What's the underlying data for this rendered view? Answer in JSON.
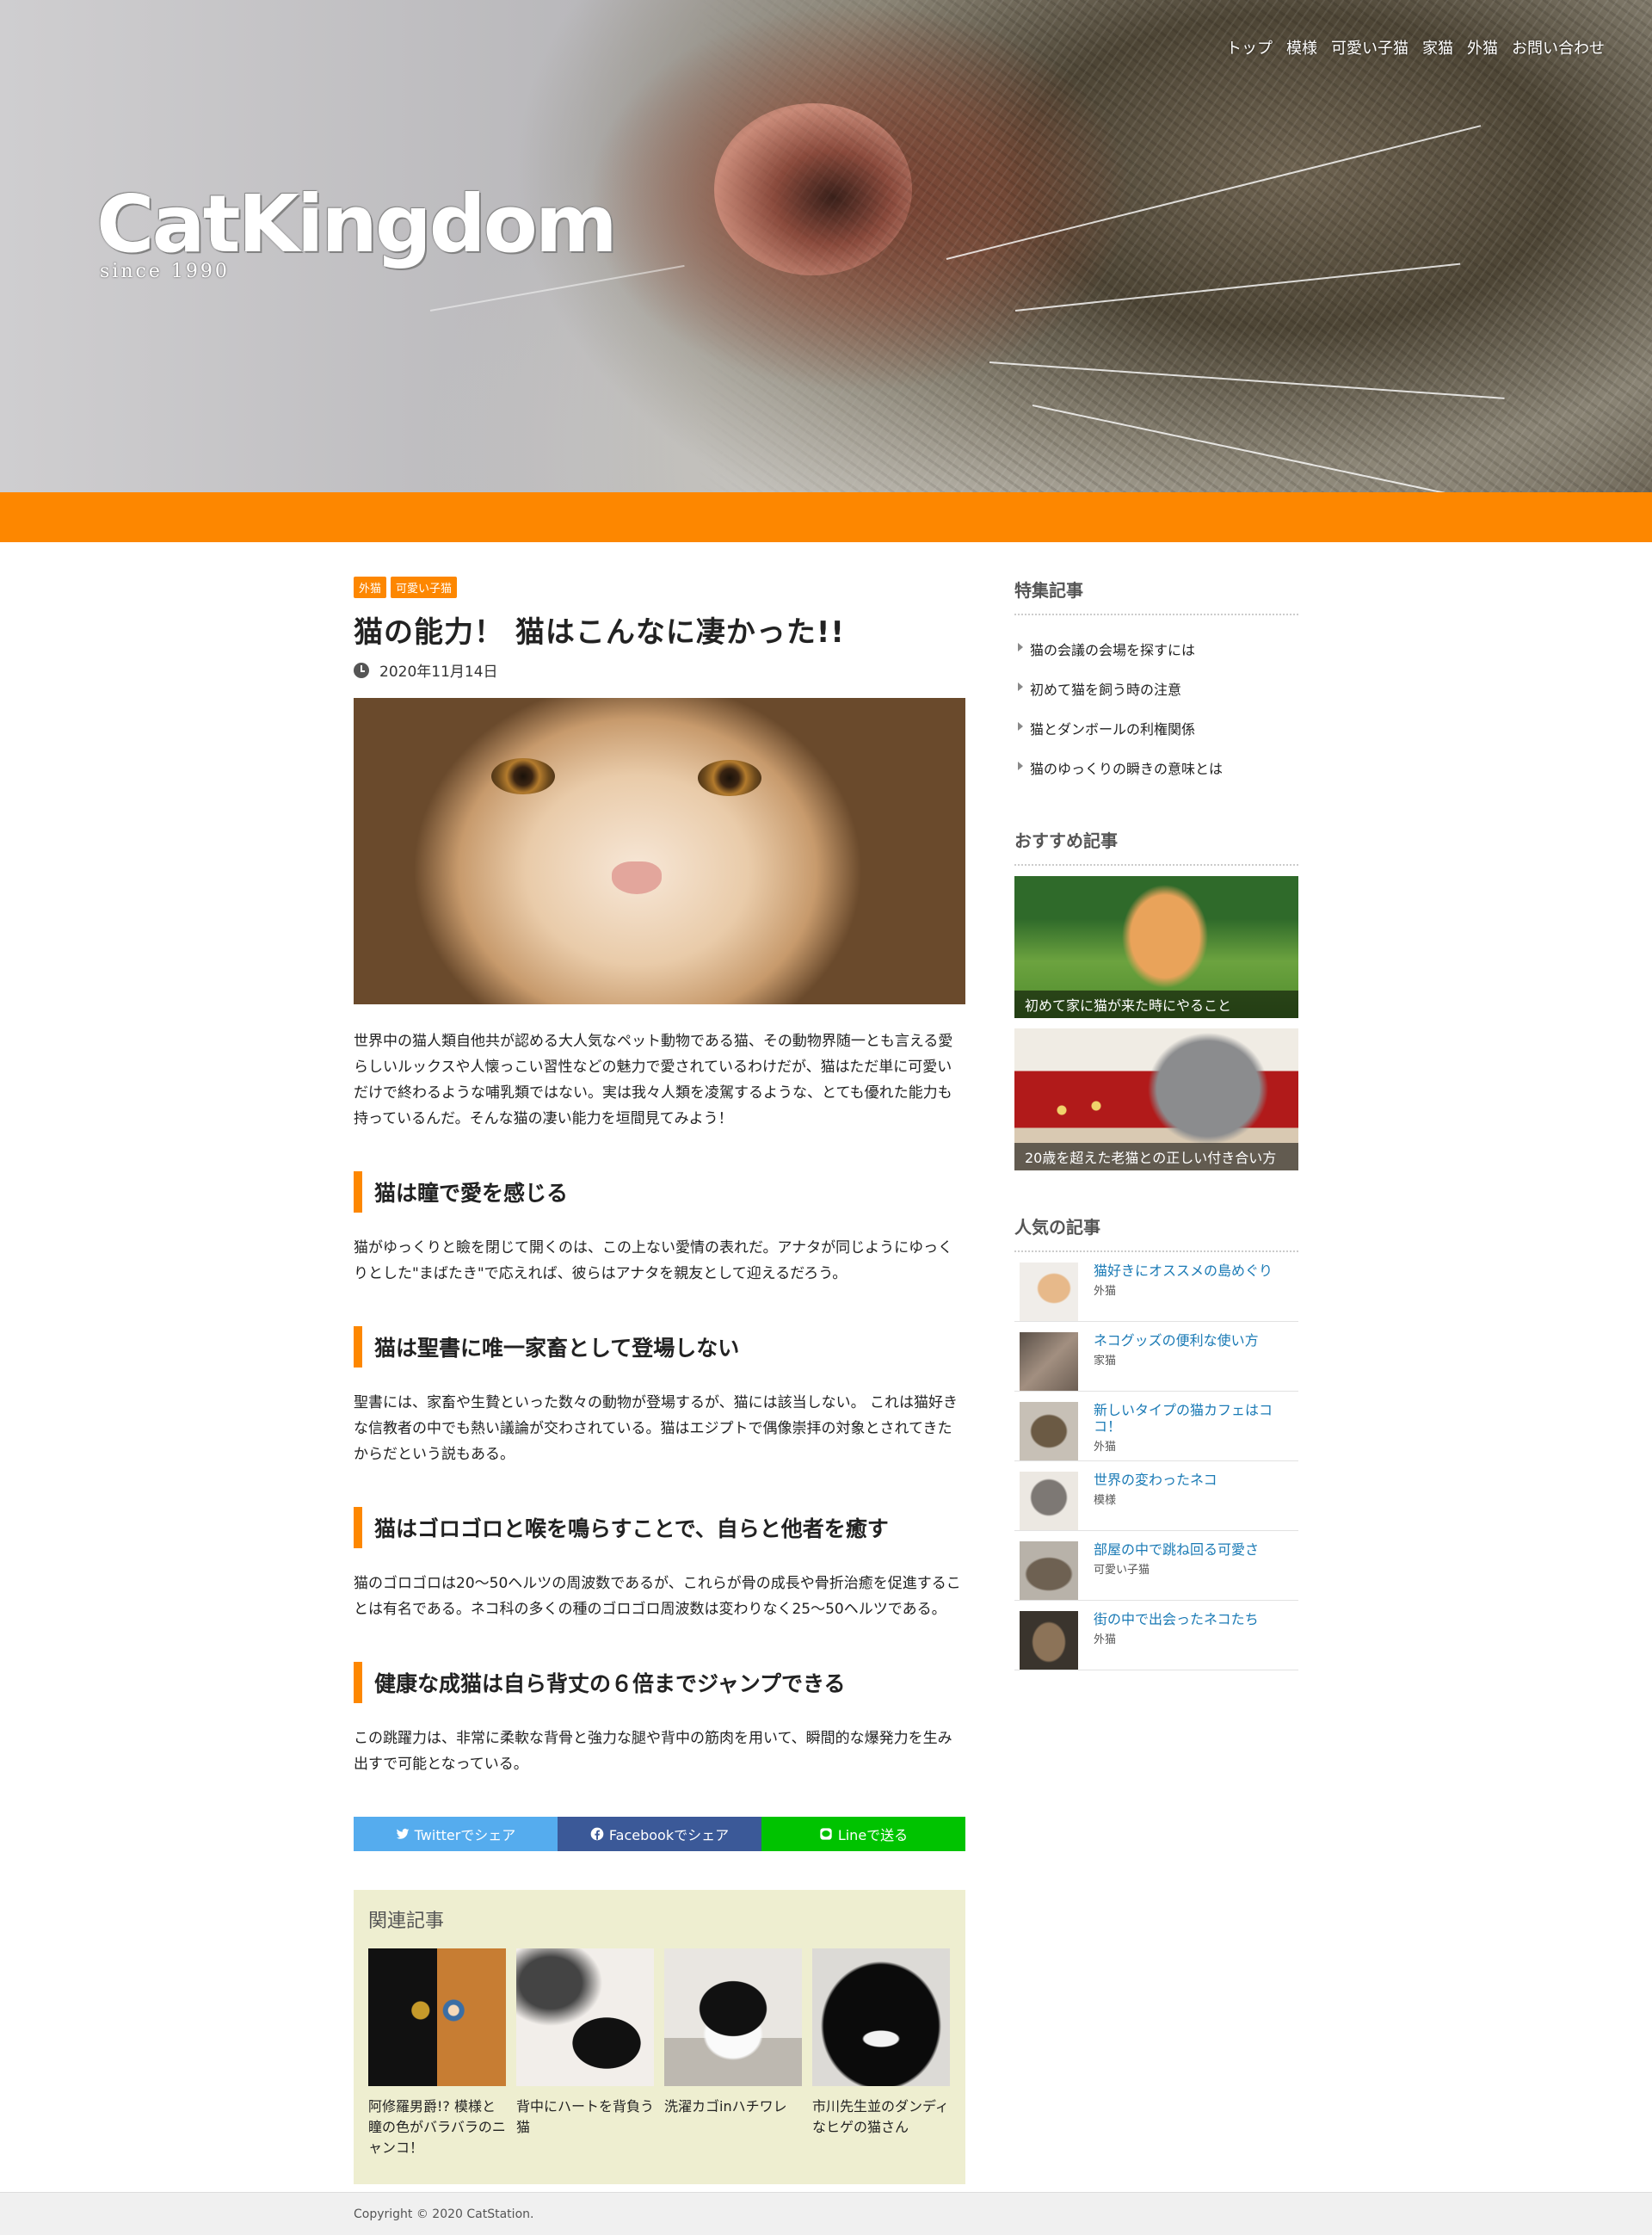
{
  "site": {
    "logo": "CatKingdom",
    "logo_since": "since 1990",
    "nav": [
      "トップ",
      "模様",
      "可愛い子猫",
      "家猫",
      "外猫",
      "お問い合わせ"
    ]
  },
  "colors": {
    "accent": "#fd8700",
    "twitter": "#55acee",
    "facebook": "#3b5998",
    "line": "#00c300",
    "related_bg": "#eeeed0",
    "link": "#1a7ab5"
  },
  "article": {
    "tags": [
      "外猫",
      "可愛い子猫"
    ],
    "title": "猫の能力！ 猫はこんなに凄かった!!",
    "date": "2020年11月14日",
    "intro": "世界中の猫人類自他共が認める大人気なペット動物である猫、その動物界随一とも言える愛らしいルックスや人懐っこい習性などの魅力で愛されているわけだが、猫はただ単に可愛いだけで終わるような哺乳類ではない。実は我々人類を凌駕するような、とても優れた能力も持っているんだ。そんな猫の凄い能力を垣間見てみよう！",
    "sections": [
      {
        "heading": "猫は瞳で愛を感じる",
        "text": "猫がゆっくりと瞼を閉じて開くのは、この上ない愛情の表れだ。アナタが同じようにゆっくりとした\"まばたき\"で応えれば、彼らはアナタを親友として迎えるだろう。"
      },
      {
        "heading": "猫は聖書に唯一家畜として登場しない",
        "text": "聖書には、家畜や生贄といった数々の動物が登場するが、猫には該当しない。 これは猫好きな信教者の中でも熱い議論が交わされている。猫はエジプトで偶像崇拝の対象とされてきたからだという説もある。"
      },
      {
        "heading": "猫はゴロゴロと喉を鳴らすことで、自らと他者を癒す",
        "text": "猫のゴロゴロは20～50ヘルツの周波数であるが、これらが骨の成長や骨折治癒を促進することは有名である。ネコ科の多くの種のゴロゴロ周波数は変わりなく25～50ヘルツである。"
      },
      {
        "heading": "健康な成猫は自ら背丈の６倍までジャンプできる",
        "text": "この跳躍力は、非常に柔軟な背骨と強力な腿や背中の筋肉を用いて、瞬間的な爆発力を生み出すで可能となっている。"
      }
    ],
    "share": {
      "twitter": "Twitterでシェア",
      "facebook": "Facebookでシェア",
      "line": "Lineで送る"
    },
    "related": {
      "heading": "関連記事",
      "items": [
        "阿修羅男爵!? 模様と瞳の色がバラバラのニャンコ！",
        "背中にハートを背負う猫",
        "洗濯カゴinハチワレ",
        "市川先生並のダンディなヒゲの猫さん"
      ]
    }
  },
  "sidebar": {
    "featured": {
      "heading": "特集記事",
      "items": [
        "猫の会議の会場を探すには",
        "初めて猫を飼う時の注意",
        "猫とダンボールの利権関係",
        "猫のゆっくりの瞬きの意味とは"
      ]
    },
    "recommended": {
      "heading": "おすすめ記事",
      "items": [
        "初めて家に猫が来た時にやること",
        "20歳を超えた老猫との正しい付き合い方"
      ]
    },
    "popular": {
      "heading": "人気の記事",
      "items": [
        {
          "title": "猫好きにオススメの島めぐり",
          "category": "外猫"
        },
        {
          "title": "ネコグッズの便利な使い方",
          "category": "家猫"
        },
        {
          "title": "新しいタイプの猫カフェはココ！",
          "category": "外猫"
        },
        {
          "title": "世界の変わったネコ",
          "category": "模様"
        },
        {
          "title": "部屋の中で跳ね回る可愛さ",
          "category": "可愛い子猫"
        },
        {
          "title": "街の中で出会ったネコたち",
          "category": "外猫"
        }
      ]
    }
  },
  "footer": {
    "copyright": "Copyright © 2020 CatStation."
  }
}
